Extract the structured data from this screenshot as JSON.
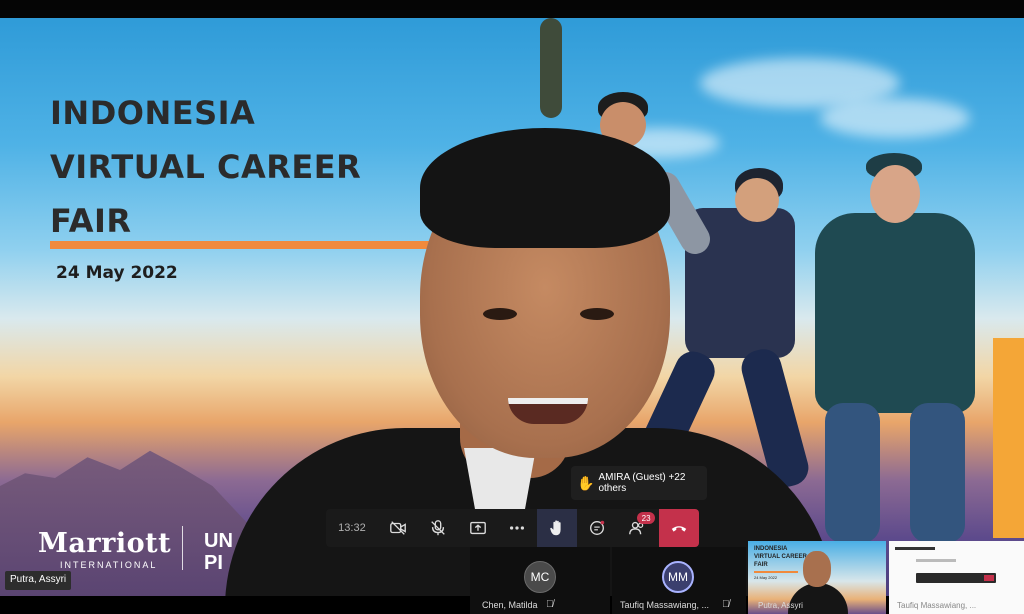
{
  "slide": {
    "title": "INDONESIA\nVIRTUAL CAREER\nFAIR",
    "date": "24 May 2022",
    "brand": "Marriott",
    "brand_sub": "INTERNATIONAL",
    "partner_partial": "UN\nPI"
  },
  "presenter": {
    "name": "Putra, Assyri"
  },
  "meeting": {
    "timer": "13:32",
    "raise_hand_tooltip": "AMIRA (Guest) +22 others",
    "participant_count": "23",
    "accent_leave": "#c4314b"
  },
  "participants": [
    {
      "initials": "MC",
      "name": "Chen, Matilda",
      "muted": true,
      "avatar_color": "#4a4a4a"
    },
    {
      "initials": "MM",
      "name": "Taufiq Massawiang, ...",
      "muted": true,
      "avatar_color": "#3b3f6e"
    }
  ],
  "thumbnails": [
    {
      "title": "INDONESIA\nVIRTUAL CAREER\nFAIR",
      "date": "24 May 2022",
      "name": "Putra, Assyri"
    },
    {
      "name": "Taufiq Massawiang, ..."
    }
  ]
}
